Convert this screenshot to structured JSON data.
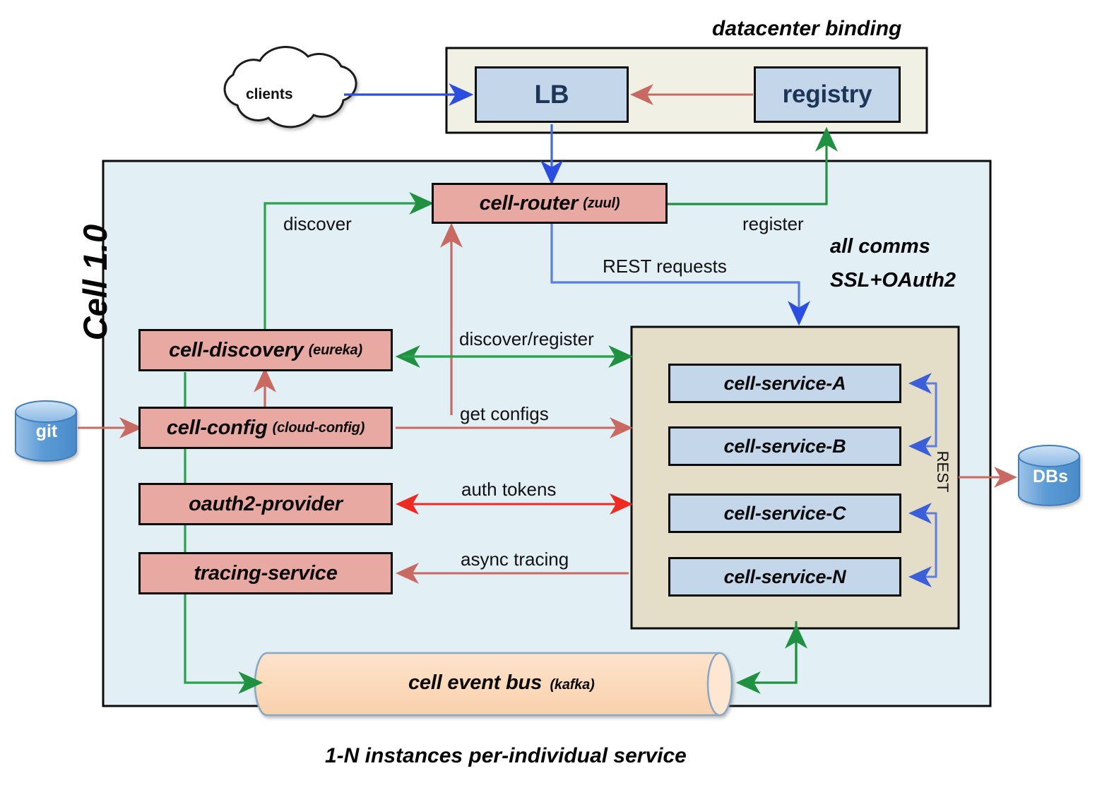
{
  "diagram": {
    "title_caption_top": "datacenter binding",
    "caption_bottom": "1-N instances per-individual service",
    "cell_label": "Cell 1.0",
    "comms_note_line1": "all comms",
    "comms_note_line2": "SSL+OAuth2"
  },
  "nodes": {
    "clients": {
      "label": "clients",
      "shape": "cloud"
    },
    "git": {
      "label": "git",
      "shape": "cylinder",
      "color": "#6fa8dc"
    },
    "dbs": {
      "label": "DBs",
      "shape": "cylinder",
      "color": "#6fa8dc"
    },
    "lb": {
      "label": "LB",
      "shape": "box",
      "color": "#c3d6ea"
    },
    "registry": {
      "label": "registry",
      "shape": "box",
      "color": "#c3d6ea"
    },
    "cell_router": {
      "name": "cell-router",
      "tech": "(zuul)",
      "color": "#e8a9a3"
    },
    "cell_discovery": {
      "name": "cell-discovery",
      "tech": "(eureka)",
      "color": "#e8a9a3"
    },
    "cell_config": {
      "name": "cell-config",
      "tech": "(cloud-config)",
      "color": "#e8a9a3"
    },
    "oauth2_provider": {
      "name": "oauth2-provider",
      "tech": "",
      "color": "#e8a9a3"
    },
    "tracing_service": {
      "name": "tracing-service",
      "tech": "",
      "color": "#e8a9a3"
    },
    "event_bus": {
      "name": "cell event bus",
      "tech": "(kafka)",
      "color": "#fcdcc0"
    },
    "services_container": {
      "label": "",
      "color": "#e4dec8"
    },
    "services": [
      {
        "label": "cell-service-A"
      },
      {
        "label": "cell-service-B"
      },
      {
        "label": "cell-service-C"
      },
      {
        "label": "cell-service-N"
      }
    ]
  },
  "edge_labels": {
    "discover": "discover",
    "register": "register",
    "rest_requests": "REST requests",
    "discover_register": "discover/register",
    "get_configs": "get configs",
    "auth_tokens": "auth tokens",
    "async_tracing": "async tracing",
    "rest": "REST"
  },
  "colors": {
    "arrow_blue": "#2b4ee0",
    "arrow_green": "#1f9141",
    "arrow_red": "#c96a62",
    "arrow_red_bright": "#ee2a21",
    "outline": "#0b0b0b",
    "cell_bg": "#e2eff5",
    "datacenter_bg": "#f0f1e4",
    "service_group_bg": "#e4dec8"
  }
}
